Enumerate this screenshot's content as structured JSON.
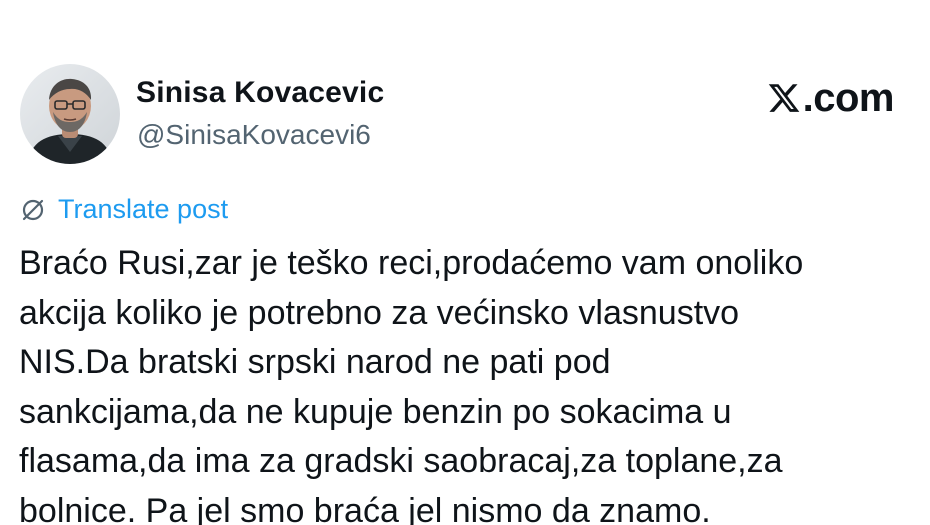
{
  "author": {
    "display_name": "Sinisa Kovacevic",
    "handle": "@SinisaKovacevi6",
    "avatar_icon": "profile-photo"
  },
  "brand": {
    "label": ".com",
    "icon": "x-logo-icon"
  },
  "translate": {
    "label": "Translate post",
    "icon": "globe-translate-icon",
    "color": "#1d9bf0"
  },
  "post": {
    "lines": [
      "Braćo Rusi,zar je teško reci,prodaćemo vam onoliko",
      "akcija koliko je potrebno za većinsko vlasnustvo",
      "NIS.Da bratski srpski narod ne pati pod",
      "sankcijama,da ne kupuje benzin po sokacima u",
      "flasama,da ima za gradski saobracaj,za toplane,za",
      "bolnice. Pa jel smo braća jel nismo da znamo."
    ]
  },
  "colors": {
    "text_primary": "#0f1419",
    "text_secondary": "#536471",
    "link": "#1d9bf0",
    "background": "#ffffff"
  }
}
